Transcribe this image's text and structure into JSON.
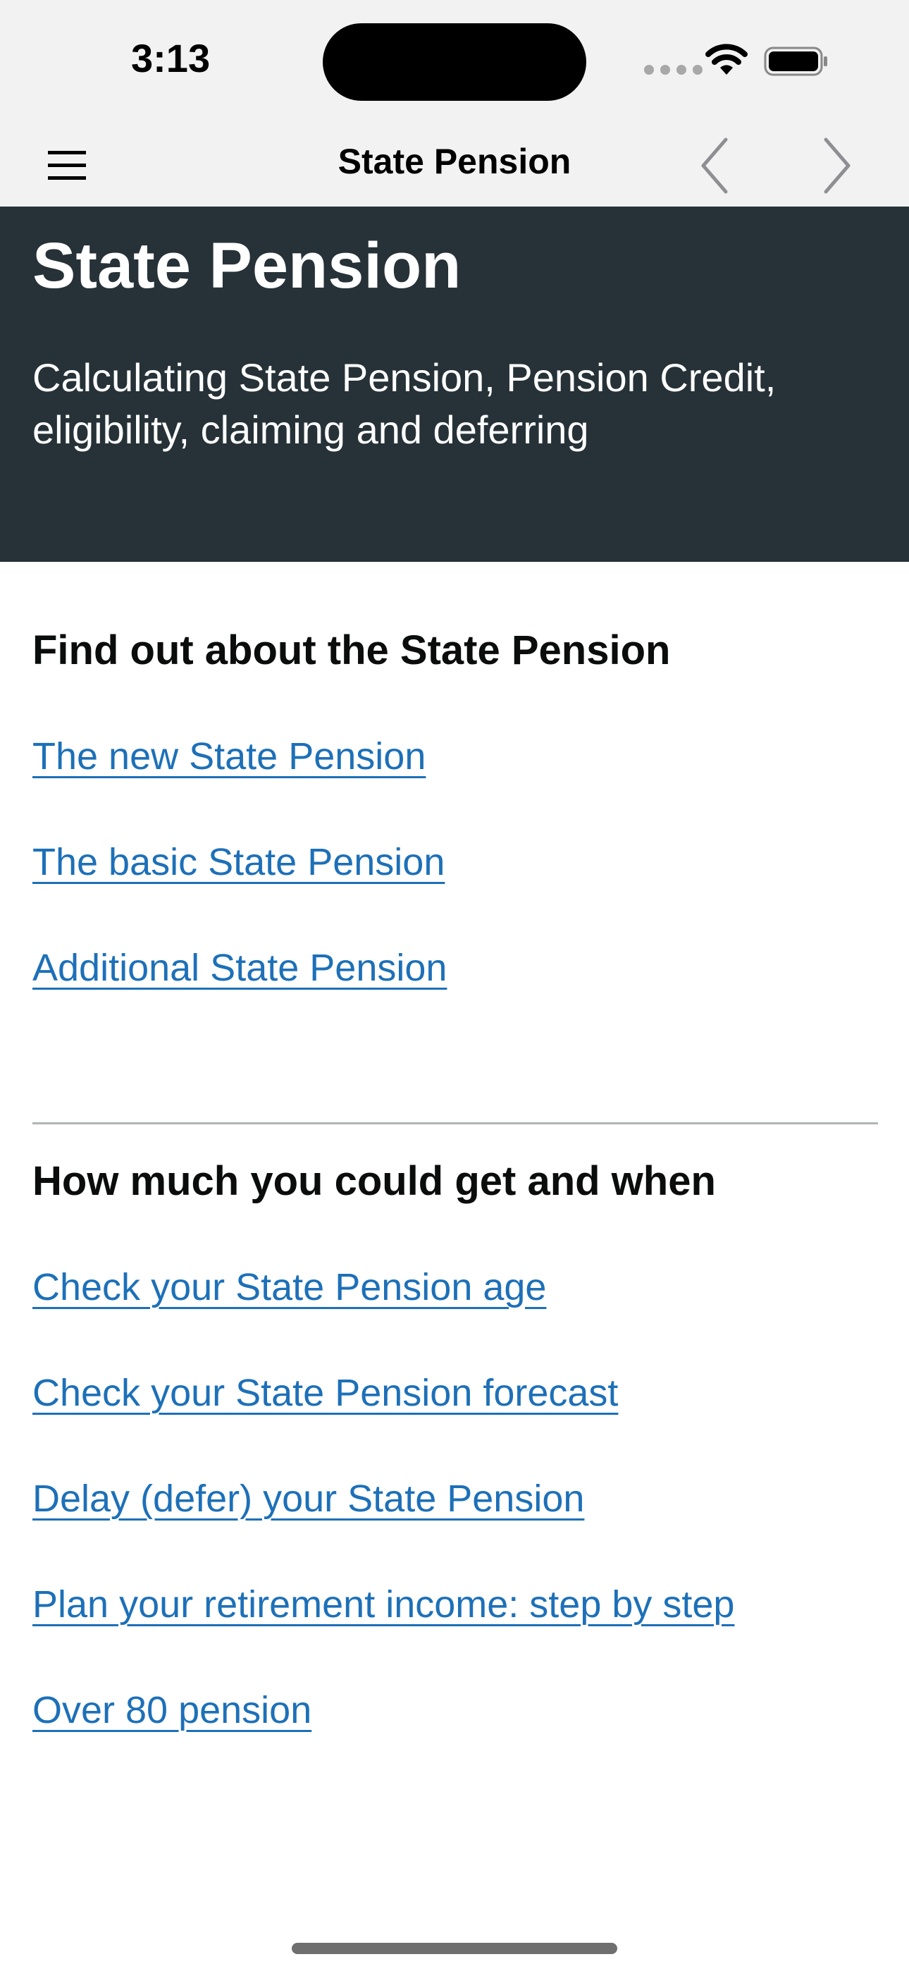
{
  "status_bar": {
    "time": "3:13"
  },
  "nav": {
    "title": "State Pension",
    "icons": {
      "menu": "hamburger-menu-icon",
      "back": "chevron-left-icon",
      "forward": "chevron-right-icon"
    }
  },
  "hero": {
    "title": "State Pension",
    "description": "Calculating State Pension, Pension Credit, eligibility, claiming and deferring",
    "background": "#263238"
  },
  "sections": [
    {
      "heading": "Find out about the State Pension",
      "links": [
        "The new State Pension",
        "The basic State Pension",
        "Additional State Pension"
      ]
    },
    {
      "heading": "How much you could get and when",
      "links": [
        "Check your State Pension age",
        "Check your State Pension forecast",
        "Delay (defer) your State Pension",
        "Plan your retirement income: step by step",
        "Over 80 pension"
      ]
    }
  ],
  "colors": {
    "link": "#1d70b8",
    "bar_background": "#f2f2f2",
    "divider": "#b1b4b6"
  }
}
